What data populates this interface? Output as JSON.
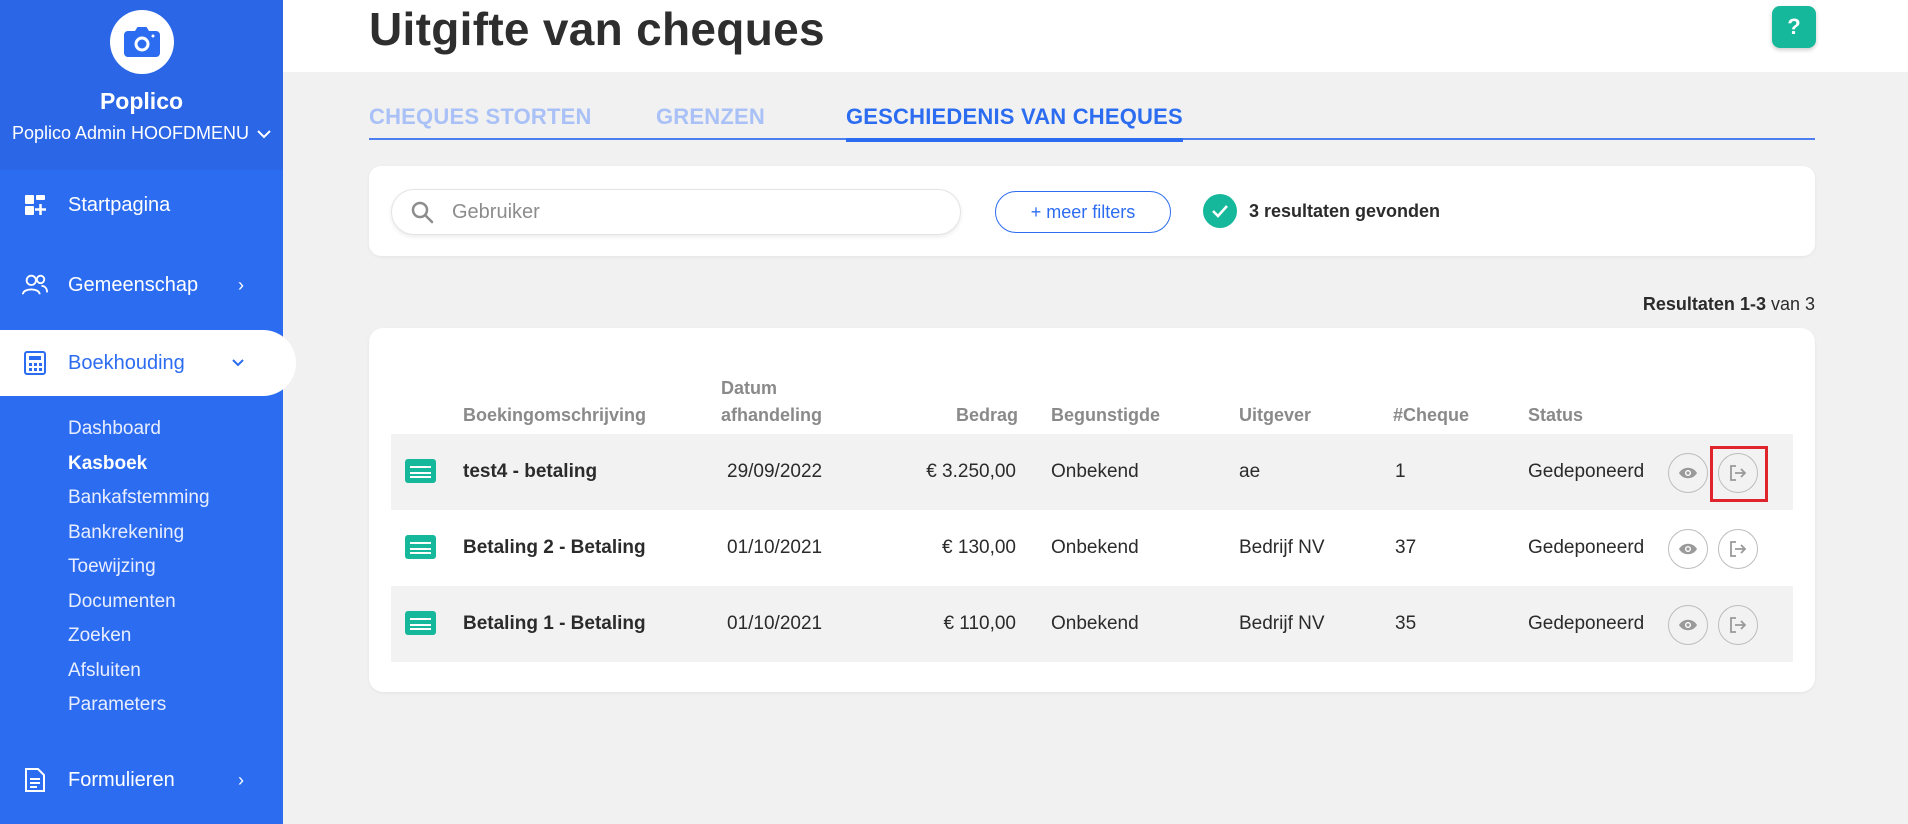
{
  "sidebar": {
    "brand_name": "Poplico",
    "user_menu": "Poplico Admin HOOFDMENU",
    "nav": [
      {
        "label": "Startpagina",
        "icon": "dashboard-icon"
      },
      {
        "label": "Gemeenschap",
        "icon": "community-icon"
      },
      {
        "label": "Boekhouding",
        "icon": "calculator-icon"
      },
      {
        "label": "Formulieren",
        "icon": "document-icon"
      }
    ],
    "subnav": [
      "Dashboard",
      "Kasboek",
      "Bankafstemming",
      "Bankrekening",
      "Toewijzing",
      "Documenten",
      "Zoeken",
      "Afsluiten",
      "Parameters"
    ],
    "active_subnav": "Kasboek"
  },
  "header": {
    "title": "Uitgifte van cheques",
    "help_label": "?"
  },
  "tabs": [
    {
      "label": "CHEQUES STORTEN"
    },
    {
      "label": "GRENZEN"
    },
    {
      "label": "GESCHIEDENIS VAN CHEQUES"
    }
  ],
  "active_tab": "GESCHIEDENIS VAN CHEQUES",
  "filters": {
    "search_placeholder": "Gebruiker",
    "more_filters_label": "+ meer filters",
    "result_count_text": "3 resultaten gevonden"
  },
  "pagination": {
    "prefix": "Resultaten ",
    "range": "1-3",
    "suffix": " van 3"
  },
  "table": {
    "columns": [
      "Boekingomschrijving",
      "Datum afhandeling",
      "Bedrag",
      "Begunstigde",
      "Uitgever",
      "#Cheque",
      "Status"
    ],
    "rows": [
      {
        "description": "test4 - betaling",
        "date": "29/09/2022",
        "amount": "€ 3.250,00",
        "beneficiary": "Onbekend",
        "issuer": "ae",
        "cheque": "1",
        "status": "Gedeponeerd"
      },
      {
        "description": "Betaling 2 - Betaling",
        "date": "01/10/2021",
        "amount": "€ 130,00",
        "beneficiary": "Onbekend",
        "issuer": "Bedrijf NV",
        "cheque": "37",
        "status": "Gedeponeerd"
      },
      {
        "description": "Betaling 1 - Betaling",
        "date": "01/10/2021",
        "amount": "€ 110,00",
        "beneficiary": "Onbekend",
        "issuer": "Bedrijf NV",
        "cheque": "35",
        "status": "Gedeponeerd"
      }
    ]
  },
  "colors": {
    "primary": "#2c6cf0",
    "accent": "#15b89a",
    "highlight": "#e0242b"
  }
}
